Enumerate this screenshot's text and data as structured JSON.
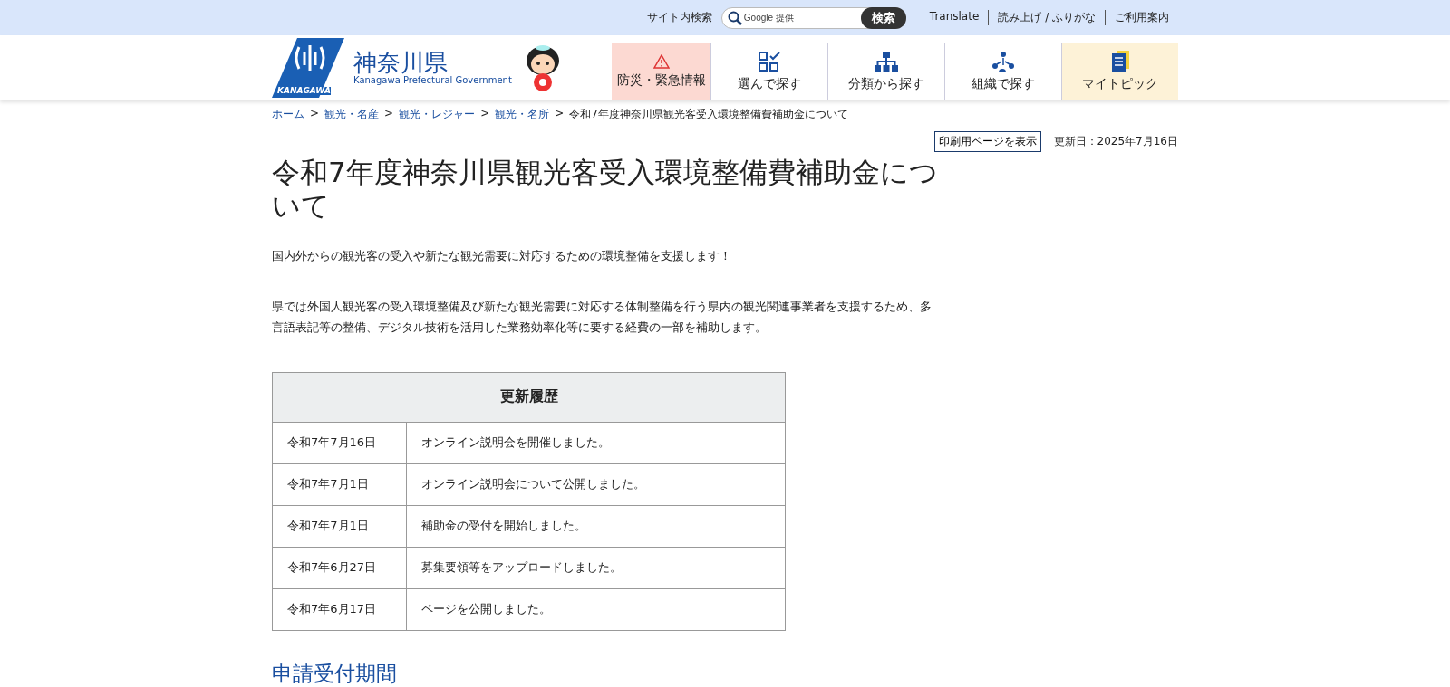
{
  "utility_bar": {
    "search_label": "サイト内検索",
    "search": {
      "placeholder": "Google 提供"
    },
    "search_button": "検索",
    "links": [
      "Translate",
      "読み上げ / ふりがな",
      "ご利用案内"
    ]
  },
  "header": {
    "logo_title": "神奈川県",
    "logo_subtitle": "Kanagawa Prefectural Government",
    "logo_mark_text": "KANAGAWA",
    "nav": [
      {
        "kind": "alert",
        "label": "防災・緊急情報"
      },
      {
        "kind": "choose",
        "label": "選んで探す"
      },
      {
        "kind": "category",
        "label": "分類から探す"
      },
      {
        "kind": "org",
        "label": "組織で探す"
      },
      {
        "kind": "mytopic",
        "label": "マイトピック"
      }
    ]
  },
  "breadcrumb": {
    "separator": ">",
    "links": [
      "ホーム",
      "観光・名産",
      "観光・レジャー",
      "観光・名所"
    ],
    "current": "令和7年度神奈川県観光客受入環境整備費補助金について"
  },
  "print_button": "印刷用ページを表示",
  "updated": "更新日：2025年7月16日",
  "title": "令和7年度神奈川県観光客受入環境整備費補助金について",
  "lead": "国内外からの観光客の受入や新たな観光需要に対応するための環境整備を支援します！",
  "body": "県では外国人観光客の受入環境整備及び新たな観光需要に対応する体制整備を行う県内の観光関連事業者を支援するため、多言語表記等の整備、デジタル技術を活用した業務効率化等に要する経費の一部を補助します。",
  "history": {
    "heading": "更新履歴",
    "rows": [
      {
        "date": "令和7年7月16日",
        "text": "オンライン説明会を開催しました。"
      },
      {
        "date": "令和7年7月1日",
        "text": "オンライン説明会について公開しました。"
      },
      {
        "date": "令和7年7月1日",
        "text": "補助金の受付を開始しました。"
      },
      {
        "date": "令和7年6月27日",
        "text": "募集要領等をアップロードしました。"
      },
      {
        "date": "令和7年6月17日",
        "text": "ページを公開しました。"
      }
    ]
  },
  "section_heading": "申請受付期間"
}
